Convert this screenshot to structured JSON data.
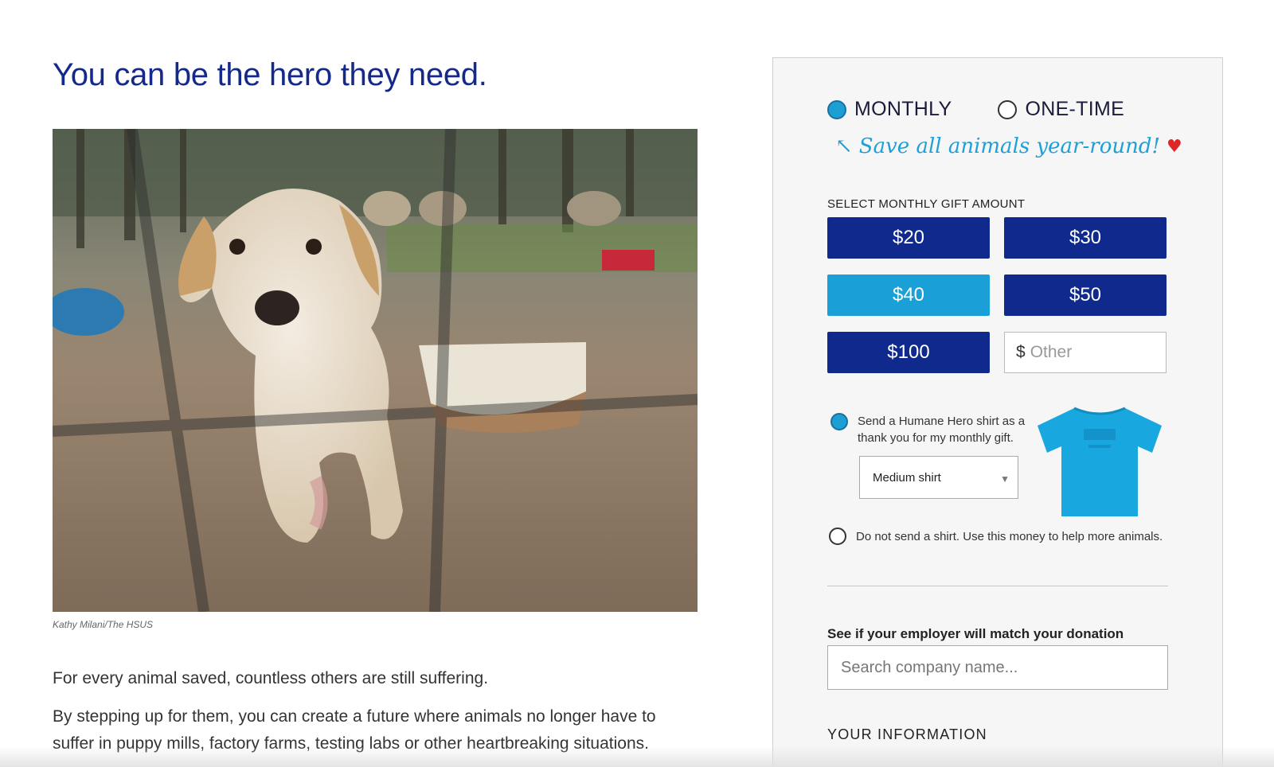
{
  "left": {
    "headline": "You can be the hero they need.",
    "photo_credit": "Kathy Milani/The HSUS",
    "paragraph1": "For every animal saved, countless others are still suffering.",
    "paragraph2": "By stepping up for them, you can create a future where animals no longer have to suffer in puppy mills, factory farms, testing labs or other heartbreaking situations."
  },
  "form": {
    "frequency": {
      "monthly_label": "MONTHLY",
      "onetime_label": "ONE-TIME",
      "selected": "MONTHLY"
    },
    "tagline": "Save all animals year-round!",
    "amount_heading": "SELECT MONTHLY GIFT AMOUNT",
    "amounts": [
      "$20",
      "$30",
      "$40",
      "$50",
      "$100"
    ],
    "selected_amount": "$40",
    "other_prefix": "$",
    "other_placeholder": "Other",
    "shirt_option_text": "Send a Humane Hero shirt as a thank you for my monthly gift.",
    "shirt_size": "Medium shirt",
    "no_shirt_text": "Do not send a shirt. Use this money to help more animals.",
    "employer_label": "See if your employer will match your donation",
    "employer_placeholder": "Search company name...",
    "your_info_heading": "YOUR INFORMATION"
  },
  "colors": {
    "headline": "#15298a",
    "button_primary": "#0f2a8c",
    "button_selected": "#1a9fd6",
    "accent": "#1fa0d6",
    "heart": "#e02626"
  }
}
